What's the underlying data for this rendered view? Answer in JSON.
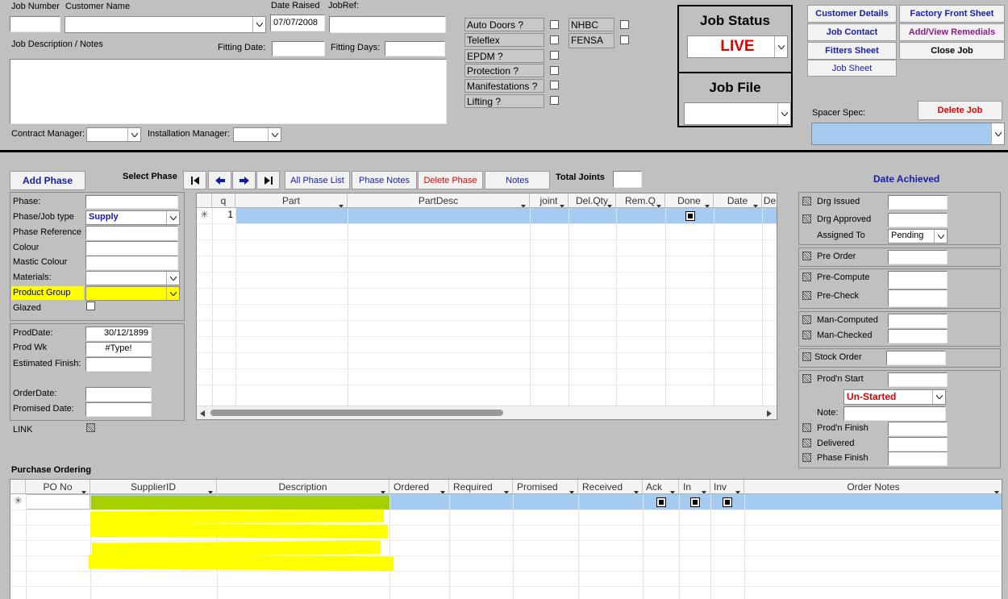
{
  "header": {
    "job_number_label": "Job Number",
    "customer_name_label": "Customer Name",
    "date_raised_label": "Date Raised",
    "date_raised_value": "07/07/2008",
    "jobref_label": "JobRef:",
    "job_description_label": "Job Description / Notes",
    "fitting_date_label": "Fitting Date:",
    "fitting_days_label": "Fitting Days:",
    "contract_manager_label": "Contract Manager:",
    "installation_manager_label": "Installation Manager:"
  },
  "options": {
    "auto_doors": "Auto Doors ?",
    "teleflex": "Teleflex",
    "epdm": "EPDM ?",
    "protection": "Protection ?",
    "manifestations": "Manifestations ?",
    "lifting": "Lifting ?",
    "nhbc": "NHBC",
    "fensa": "FENSA"
  },
  "job_status": {
    "title": "Job Status",
    "value": "LIVE",
    "file_title": "Job File"
  },
  "right_buttons": {
    "customer_details": "Customer  Details",
    "factory_front_sheet": "Factory Front Sheet",
    "job_contact": "Job Contact",
    "add_view_remedials": "Add/View Remedials",
    "fitters_sheet": "Fitters Sheet",
    "close_job": "Close Job",
    "job_sheet": "Job Sheet",
    "spacer_spec_label": "Spacer Spec:",
    "delete_job": "Delete Job"
  },
  "phase_toolbar": {
    "add_phase": "Add Phase",
    "select_phase": "Select Phase",
    "all_phase_list": "All Phase List",
    "phase_notes": "Phase Notes",
    "delete_phase": "Delete Phase",
    "notes": "Notes",
    "total_joints": "Total Joints"
  },
  "phase_form": {
    "phase_label": "Phase:",
    "phase_type_label": "Phase/Job type",
    "phase_type_value": "Supply",
    "phase_reference_label": "Phase Reference",
    "colour_label": "Colour",
    "mastic_colour_label": "Mastic Colour",
    "materials_label": "Materials:",
    "product_group_label": "Product Group",
    "glazed_label": "Glazed",
    "prod_date_label": "ProdDate:",
    "prod_date_value": "30/12/1899",
    "prod_wk_label": "Prod Wk",
    "prod_wk_value": "#Type!",
    "estimated_finish_label": "Estimated Finish:",
    "order_date_label": "OrderDate:",
    "promised_date_label": "Promised Date:",
    "link_label": "LINK"
  },
  "parts_grid": {
    "columns": [
      "q",
      "Part",
      "PartDesc",
      "joint",
      "Del.Qty",
      "Rem.Q",
      "Done",
      "Date",
      "De"
    ],
    "new_row_marker": "✳",
    "new_row_qty": "1"
  },
  "date_achieved": {
    "title": "Date Achieved",
    "drg_issued": "Drg Issued",
    "drg_approved": "Drg Approved",
    "assigned_to": "Assigned To",
    "assigned_value": "Pending",
    "pre_order": "Pre Order",
    "pre_compute": "Pre-Compute",
    "pre_check": "Pre-Check",
    "man_computed": "Man-Computed",
    "man_checked": "Man-Checked",
    "stock_order": "Stock Order",
    "prodn_start": "Prod'n Start",
    "prodn_status": "Un-Started",
    "note_label": "Note:",
    "prodn_finish": "Prod'n Finish",
    "delivered": "Delivered",
    "phase_finish": "Phase Finish"
  },
  "purchase_ordering": {
    "title": "Purchase Ordering",
    "columns": [
      "PO  No",
      "SupplierID",
      "Description",
      "Ordered",
      "Required",
      "Promised",
      "Received",
      "Ack",
      "In",
      "Inv",
      "Order Notes"
    ],
    "new_row_marker": "✳"
  },
  "colors": {
    "form_bg": "#c0c0c0",
    "accent_blue": "#1a1aa8",
    "live_red": "#e00000",
    "row_highlight": "#a6cbf0",
    "marker_yellow": "#ffff00",
    "marker_green": "#a8d000"
  }
}
